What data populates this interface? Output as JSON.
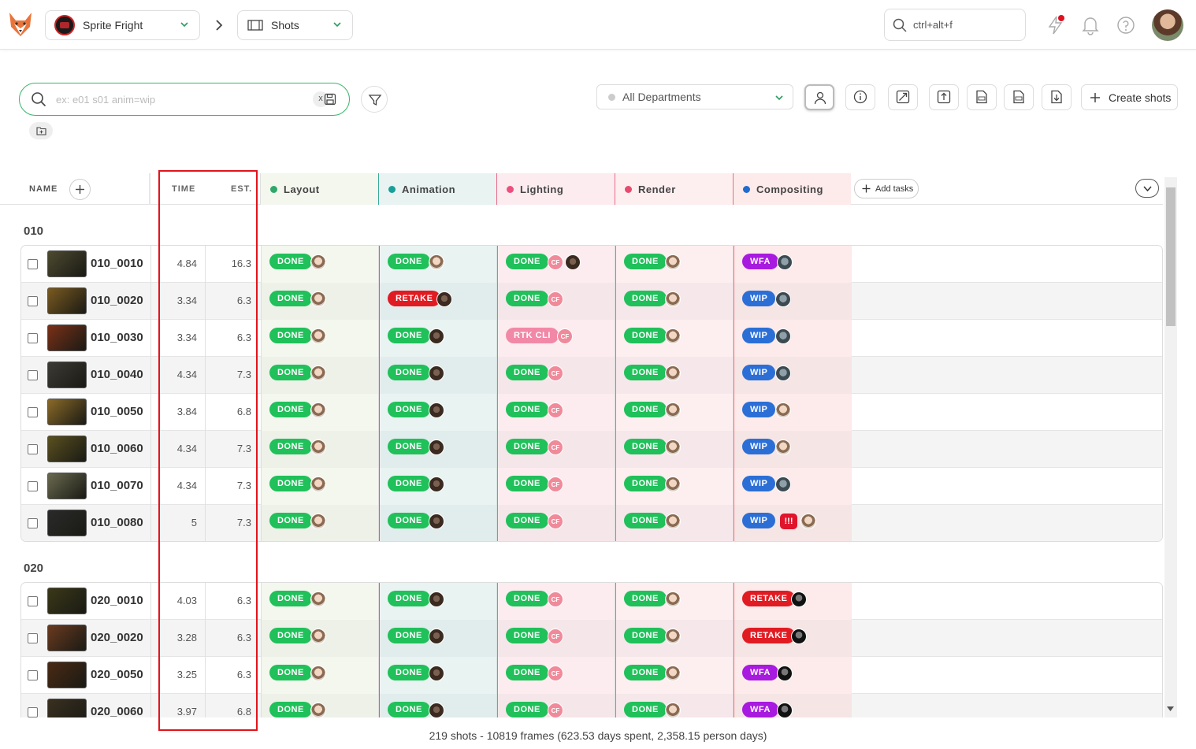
{
  "topbar": {
    "production": "Sprite Fright",
    "section": "Shots",
    "search_placeholder": "ctrl+alt+f"
  },
  "filters": {
    "search_placeholder": "ex: e01 s01 anim=wip",
    "clear_label": "x",
    "department": "All Departments",
    "create_label": "Create shots"
  },
  "columns": {
    "name": "NAME",
    "time": "TIME",
    "est": "EST.",
    "add_tasks": "Add tasks",
    "tasks": [
      {
        "label": "Layout",
        "color": "#2fa86a"
      },
      {
        "label": "Animation",
        "color": "#16a098"
      },
      {
        "label": "Lighting",
        "color": "#ee4e7e"
      },
      {
        "label": "Render",
        "color": "#e84a6e"
      },
      {
        "label": "Compositing",
        "color": "#1f6bd0"
      }
    ]
  },
  "sequences": [
    {
      "name": "010",
      "shots": [
        {
          "name": "010_0010",
          "time": "4.84",
          "est": "16.3",
          "thumb": "#4d4a30",
          "tasks": [
            {
              "status": "DONE",
              "people": [
                "w"
              ]
            },
            {
              "status": "DONE",
              "people": [
                "w"
              ]
            },
            {
              "status": "DONE",
              "people": [
                "cf",
                "m"
              ]
            },
            {
              "status": "DONE",
              "people": [
                "w"
              ]
            },
            {
              "status": "WFA",
              "people": [
                "g"
              ]
            }
          ]
        },
        {
          "name": "010_0020",
          "time": "3.34",
          "est": "6.3",
          "thumb": "#7a5a20",
          "tasks": [
            {
              "status": "DONE",
              "people": [
                "w"
              ]
            },
            {
              "status": "RETAKE",
              "people": [
                "m"
              ]
            },
            {
              "status": "DONE",
              "people": [
                "cf"
              ]
            },
            {
              "status": "DONE",
              "people": [
                "w"
              ]
            },
            {
              "status": "WIP",
              "people": [
                "g"
              ]
            }
          ]
        },
        {
          "name": "010_0030",
          "time": "3.34",
          "est": "6.3",
          "thumb": "#7a3018",
          "tasks": [
            {
              "status": "DONE",
              "people": [
                "w"
              ]
            },
            {
              "status": "DONE",
              "people": [
                "m"
              ]
            },
            {
              "status": "RTK CLI",
              "people": [
                "cf"
              ]
            },
            {
              "status": "DONE",
              "people": [
                "w"
              ]
            },
            {
              "status": "WIP",
              "people": [
                "g"
              ]
            }
          ]
        },
        {
          "name": "010_0040",
          "time": "4.34",
          "est": "7.3",
          "thumb": "#3c3a34",
          "tasks": [
            {
              "status": "DONE",
              "people": [
                "w"
              ]
            },
            {
              "status": "DONE",
              "people": [
                "m"
              ]
            },
            {
              "status": "DONE",
              "people": [
                "cf"
              ]
            },
            {
              "status": "DONE",
              "people": [
                "w"
              ]
            },
            {
              "status": "WIP",
              "people": [
                "g"
              ]
            }
          ]
        },
        {
          "name": "010_0050",
          "time": "3.84",
          "est": "6.8",
          "thumb": "#8a6a28",
          "tasks": [
            {
              "status": "DONE",
              "people": [
                "w"
              ]
            },
            {
              "status": "DONE",
              "people": [
                "m"
              ]
            },
            {
              "status": "DONE",
              "people": [
                "cf"
              ]
            },
            {
              "status": "DONE",
              "people": [
                "w"
              ]
            },
            {
              "status": "WIP",
              "people": [
                "w"
              ]
            }
          ]
        },
        {
          "name": "010_0060",
          "time": "4.34",
          "est": "7.3",
          "thumb": "#5a5020",
          "tasks": [
            {
              "status": "DONE",
              "people": [
                "w"
              ]
            },
            {
              "status": "DONE",
              "people": [
                "m"
              ]
            },
            {
              "status": "DONE",
              "people": [
                "cf"
              ]
            },
            {
              "status": "DONE",
              "people": [
                "w"
              ]
            },
            {
              "status": "WIP",
              "people": [
                "w"
              ]
            }
          ]
        },
        {
          "name": "010_0070",
          "time": "4.34",
          "est": "7.3",
          "thumb": "#6a6a50",
          "tasks": [
            {
              "status": "DONE",
              "people": [
                "w"
              ]
            },
            {
              "status": "DONE",
              "people": [
                "m"
              ]
            },
            {
              "status": "DONE",
              "people": [
                "cf"
              ]
            },
            {
              "status": "DONE",
              "people": [
                "w"
              ]
            },
            {
              "status": "WIP",
              "people": [
                "g"
              ]
            }
          ]
        },
        {
          "name": "010_0080",
          "time": "5",
          "est": "7.3",
          "thumb": "#2a2a2a",
          "tasks": [
            {
              "status": "DONE",
              "people": [
                "w"
              ]
            },
            {
              "status": "DONE",
              "people": [
                "m"
              ]
            },
            {
              "status": "DONE",
              "people": [
                "cf"
              ]
            },
            {
              "status": "DONE",
              "people": [
                "w"
              ]
            },
            {
              "status": "WIP",
              "people": [
                "!!!",
                "w"
              ]
            }
          ]
        }
      ]
    },
    {
      "name": "020",
      "shots": [
        {
          "name": "020_0010",
          "time": "4.03",
          "est": "6.3",
          "thumb": "#3a3818",
          "tasks": [
            {
              "status": "DONE",
              "people": [
                "w"
              ]
            },
            {
              "status": "DONE",
              "people": [
                "m"
              ]
            },
            {
              "status": "DONE",
              "people": [
                "cf"
              ]
            },
            {
              "status": "DONE",
              "people": [
                "w"
              ]
            },
            {
              "status": "RETAKE",
              "people": [
                "b"
              ]
            }
          ]
        },
        {
          "name": "020_0020",
          "time": "3.28",
          "est": "6.3",
          "thumb": "#6a3a20",
          "tasks": [
            {
              "status": "DONE",
              "people": [
                "w"
              ]
            },
            {
              "status": "DONE",
              "people": [
                "m"
              ]
            },
            {
              "status": "DONE",
              "people": [
                "cf"
              ]
            },
            {
              "status": "DONE",
              "people": [
                "w"
              ]
            },
            {
              "status": "RETAKE",
              "people": [
                "b"
              ]
            }
          ]
        },
        {
          "name": "020_0050",
          "time": "3.25",
          "est": "6.3",
          "thumb": "#4a2a14",
          "tasks": [
            {
              "status": "DONE",
              "people": [
                "w"
              ]
            },
            {
              "status": "DONE",
              "people": [
                "m"
              ]
            },
            {
              "status": "DONE",
              "people": [
                "cf"
              ]
            },
            {
              "status": "DONE",
              "people": [
                "w"
              ]
            },
            {
              "status": "WFA",
              "people": [
                "b"
              ]
            }
          ]
        },
        {
          "name": "020_0060",
          "time": "3.97",
          "est": "6.8",
          "thumb": "#3a3020",
          "tasks": [
            {
              "status": "DONE",
              "people": [
                "w"
              ]
            },
            {
              "status": "DONE",
              "people": [
                "m"
              ]
            },
            {
              "status": "DONE",
              "people": [
                "cf"
              ]
            },
            {
              "status": "DONE",
              "people": [
                "w"
              ]
            },
            {
              "status": "WFA",
              "people": [
                "b"
              ]
            }
          ]
        }
      ]
    }
  ],
  "footer": "219 shots - 10819 frames (623.53 days spent, 2,358.15 person days)"
}
